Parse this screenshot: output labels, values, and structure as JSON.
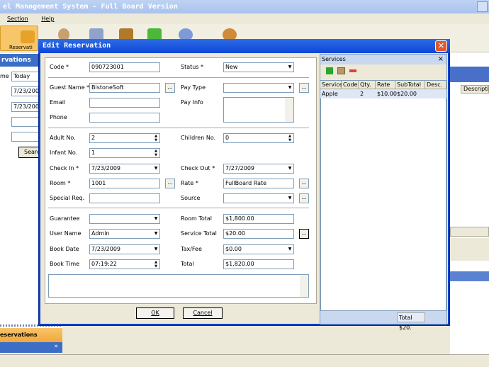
{
  "app": {
    "title": "el Management System - Full Board Version"
  },
  "menu": {
    "items": [
      "Section",
      "Help"
    ]
  },
  "toolbar": {
    "reservation_label": "Reservati"
  },
  "left_panel": {
    "header": "rvations",
    "me_label": "me",
    "period": "Today",
    "date1": "7/23/2009",
    "date2": "7/23/2009",
    "search_label": "Searc",
    "reservations_tab": "eservations",
    "expand": "»"
  },
  "right_background": {
    "column_label": "Descriptio"
  },
  "dialog": {
    "title": "Edit Reservation",
    "close": "✕",
    "code_label": "Code *",
    "code": "090723001",
    "status_label": "Status *",
    "status": "New",
    "guest_label": "Guest Name *",
    "guest": "BistoneSoft",
    "paytype_label": "Pay Type",
    "paytype": "",
    "email_label": "Email",
    "email": "",
    "payinfo_label": "Pay Info",
    "phone_label": "Phone",
    "phone": "",
    "adult_label": "Adult No.",
    "adult": "2",
    "children_label": "Children No.",
    "children": "0",
    "infant_label": "Infant No.",
    "infant": "1",
    "checkin_label": "Check In *",
    "checkin": "7/23/2009",
    "checkout_label": "Check Out *",
    "checkout": "7/27/2009",
    "room_label": "Room *",
    "room": "1001",
    "rate_label": "Rate *",
    "rate": "FullBoard Rate",
    "special_label": "Special Req.",
    "special": "",
    "source_label": "Source",
    "source": "",
    "guarantee_label": "Guarantee",
    "guarantee": "",
    "roomtotal_label": "Room Total",
    "roomtotal": "$1,800.00",
    "user_label": "User Name",
    "user": "Admin",
    "servicetotal_label": "Service Total",
    "servicetotal": "$20.00",
    "bookdate_label": "Book Date",
    "bookdate": "7/23/2009",
    "taxfee_label": "Tax/Fee",
    "taxfee": "$0.00",
    "booktime_label": "Book Time",
    "booktime": "07:19:22",
    "total_label": "Total",
    "total": "$1,820.00",
    "ok": "OK",
    "cancel": "Cancel",
    "dots": "..."
  },
  "services": {
    "title": "Services",
    "close": "×",
    "columns": [
      "Service",
      "Code",
      "Qty.",
      "Rate",
      "SubTotal",
      "Desc."
    ],
    "rows": [
      {
        "service": "Apple",
        "code": "",
        "qty": "2",
        "rate": "$10.00",
        "subtotal": "$20.00",
        "desc": ""
      }
    ],
    "total": "Total $20."
  },
  "colors": {
    "dialog_blue": "#0b41c8",
    "title_gradient": "#2e6de6",
    "accent_orange": "#f0a83a",
    "close_red": "#e15a2e"
  }
}
